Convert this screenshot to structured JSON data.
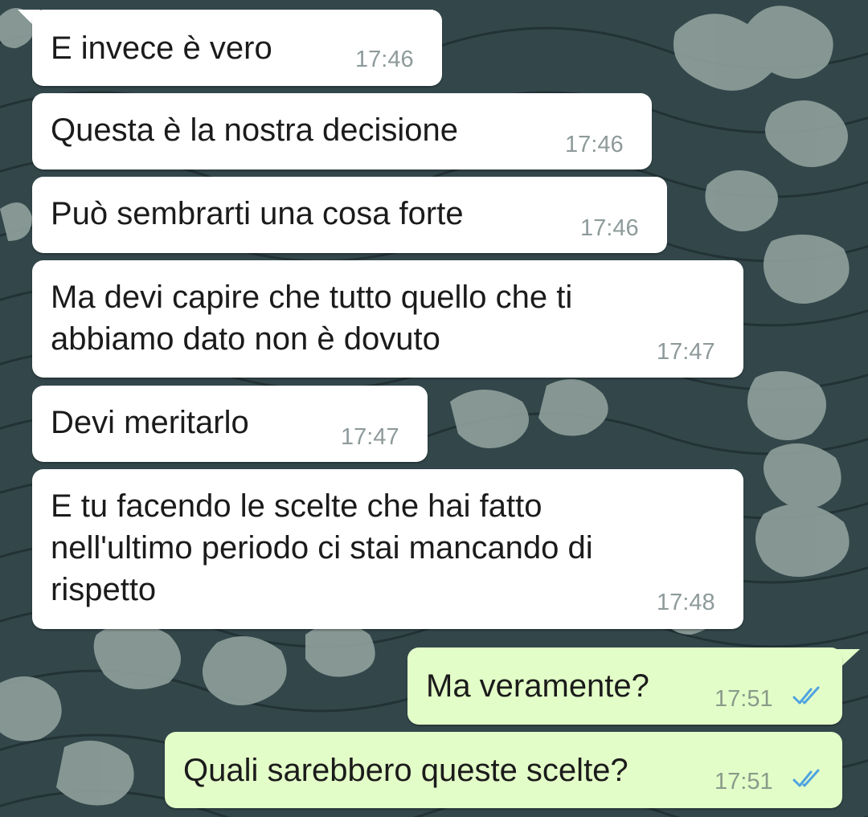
{
  "colors": {
    "incoming_bubble": "#ffffff",
    "outgoing_bubble": "#e3fdc8",
    "read_ticks": "#4fa3e0",
    "wallpaper": "#33474a"
  },
  "messages": [
    {
      "text": "E invece è vero",
      "time": "17:46",
      "direction": "incoming"
    },
    {
      "text": "Questa è la nostra decisione",
      "time": "17:46",
      "direction": "incoming"
    },
    {
      "text": "Può sembrarti una cosa forte",
      "time": "17:46",
      "direction": "incoming"
    },
    {
      "text": "Ma devi capire che tutto quello che ti\nabbiamo dato non è dovuto",
      "time": "17:47",
      "direction": "incoming"
    },
    {
      "text": "Devi meritarlo",
      "time": "17:47",
      "direction": "incoming"
    },
    {
      "text": "E tu facendo le scelte che hai fatto\nnell'ultimo periodo ci stai mancando di\nrispetto",
      "time": "17:48",
      "direction": "incoming"
    },
    {
      "text": "Ma veramente?",
      "time": "17:51",
      "direction": "outgoing",
      "status_icon": "double-check-read-icon"
    },
    {
      "text": "Quali sarebbero queste scelte?",
      "time": "17:51",
      "direction": "outgoing",
      "status_icon": "double-check-read-icon"
    }
  ]
}
